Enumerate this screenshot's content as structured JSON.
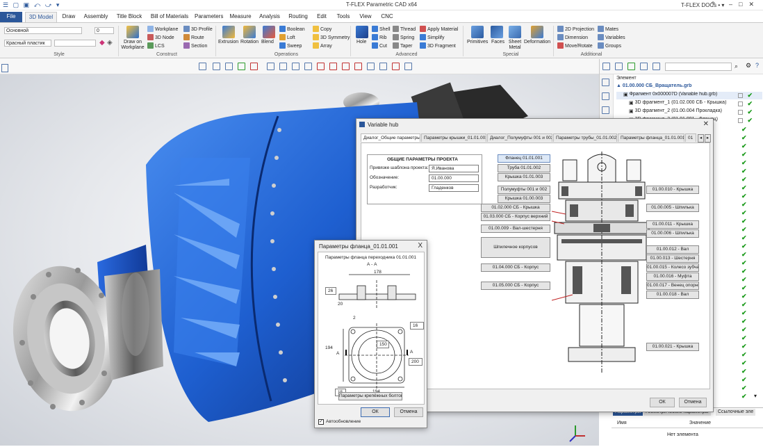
{
  "window": {
    "title": "T-FLEX Parametric CAD x64",
    "docs_label": "T-FLEX DOCs",
    "help": "?"
  },
  "tabs": [
    "File",
    "3D Model",
    "Draw",
    "Assembly",
    "Title Block",
    "Bill of Materials",
    "Parameters",
    "Measure",
    "Analysis",
    "Routing",
    "Edit",
    "Tools",
    "View",
    "CNC"
  ],
  "ribbon": {
    "style": {
      "layer_value": "Основной",
      "width_value": "0",
      "material_value": "Красный пластик",
      "label": "Style"
    },
    "construct": {
      "draw_on_workplane": "Draw on Workplane",
      "workplane": "Workplane",
      "node3d": "3D Node",
      "lcs": "LCS",
      "profile3d": "3D Profile",
      "route": "Route",
      "section": "Section",
      "label": "Construct"
    },
    "operations": {
      "extrusion": "Extrusion",
      "rotation": "Rotation",
      "blend": "Blend",
      "boolean": "Boolean",
      "loft": "Loft",
      "sweep": "Sweep",
      "copy": "Copy",
      "symmetry3d": "3D Symmetry",
      "array": "Array",
      "label": "Operations"
    },
    "advanced": {
      "hole": "Hole",
      "shell": "Shell",
      "rib": "Rib",
      "cut": "Cut",
      "thread": "Thread",
      "spring": "Spring",
      "taper": "Taper",
      "apply_material": "Apply Material",
      "simplify": "Simplify",
      "fragment3d": "3D Fragment",
      "label": "Advanced"
    },
    "special": {
      "primitives": "Primitives",
      "faces": "Faces",
      "sheet_metal": "Sheet Metal",
      "deformation": "Deformation",
      "label": "Special"
    },
    "additional": {
      "projection2d": "2D Projection",
      "dimension": "Dimension",
      "move_rotate": "Move/Rotate",
      "mates": "Mates",
      "variables": "Variables",
      "groups": "Groups",
      "label": "Additional"
    }
  },
  "tree": {
    "header": "Элемент",
    "rows": [
      {
        "text": "01.00.000 СБ_Вращатель.grb",
        "level": 0
      },
      {
        "text": "Фрагмент 0x000007D (Variable hub.grb)",
        "level": 1
      },
      {
        "text": "3D фрагмент_1 (01.02.000 СБ - Крышка)",
        "level": 2
      },
      {
        "text": "3D фрагмент_2 (01.00.004 Прокладка)",
        "level": 2
      },
      {
        "text": "3D фрагмент_3 (01.01.001 - Фланец)",
        "level": 2
      }
    ]
  },
  "props": {
    "tab1": "Параметры",
    "tab2": "Геометрические параметры",
    "tab3": "Ссылочные эле",
    "col_name": "Имя",
    "col_value": "Значение",
    "empty": "Нет элемента"
  },
  "main_dialog": {
    "title": "Variable hub",
    "tabs": [
      "Диалог_Общие параметры",
      "Параметры крышки_01.01.003",
      "Диалог_Полумуфты 001 и 002",
      "Параметры трубы_01.01.002",
      "Параметры фланца_01.01.001",
      "01"
    ],
    "project": {
      "heading": "ОБЩИЕ ПАРАМЕТРЫ ПРОЕКТА",
      "fields": [
        {
          "label": "Привязке шаблона проекта:",
          "value": "Я.Иванова"
        },
        {
          "label": "Обозначение:",
          "value": "01.00.000"
        },
        {
          "label": "Разработчик:",
          "value": "Гладенков"
        }
      ]
    },
    "left_buttons": [
      "Фланец 01.01.001",
      "Труба 01.01.002",
      "Крышка 01.01.003",
      "Полумуфты 001 и 002",
      "Крышка 01.00.003",
      "01.02.000 СБ - Крышка",
      "01.03.000 СБ - Корпус верхний",
      "01.00.009 - Вал-шестерня",
      "Шпилечное корпусов",
      "01.04.000 СБ - Корпус",
      "01.05.000 СБ - Корпус"
    ],
    "right_buttons": [
      "01.00.010 - Крышка",
      "01.00.005 - Шпилька",
      "01.00.011 - Крышка",
      "01.00.006 - Шпилька",
      "01.00.012 - Вал",
      "01.00.013 - Шестерня",
      "01.00.015 - Колесо зубчатое",
      "01.00.016 - Муфта",
      "01.00.017 - Венец опорный",
      "01.00.018 - Вал",
      "01.00.021 - Крышка"
    ],
    "ok": "ОК",
    "cancel": "Отмена"
  },
  "flange_dialog": {
    "title": "Параметры фланца_01.01.001",
    "heading": "Параметры фланца переходника 01.01.001",
    "section": "А - А",
    "dims": {
      "d178": "178",
      "d26": "26",
      "d20": "20",
      "d2": "2",
      "d16": "16",
      "d150": "150",
      "d200": "200",
      "d194a": "194",
      "d194b": "194",
      "d15": "15",
      "a_left": "А",
      "a_right": "А"
    },
    "bolts_button": "Параметры крепёжных болтов",
    "ok": "ОК",
    "cancel": "Отмена",
    "autoupdate": "Автообновление",
    "close": "X"
  }
}
